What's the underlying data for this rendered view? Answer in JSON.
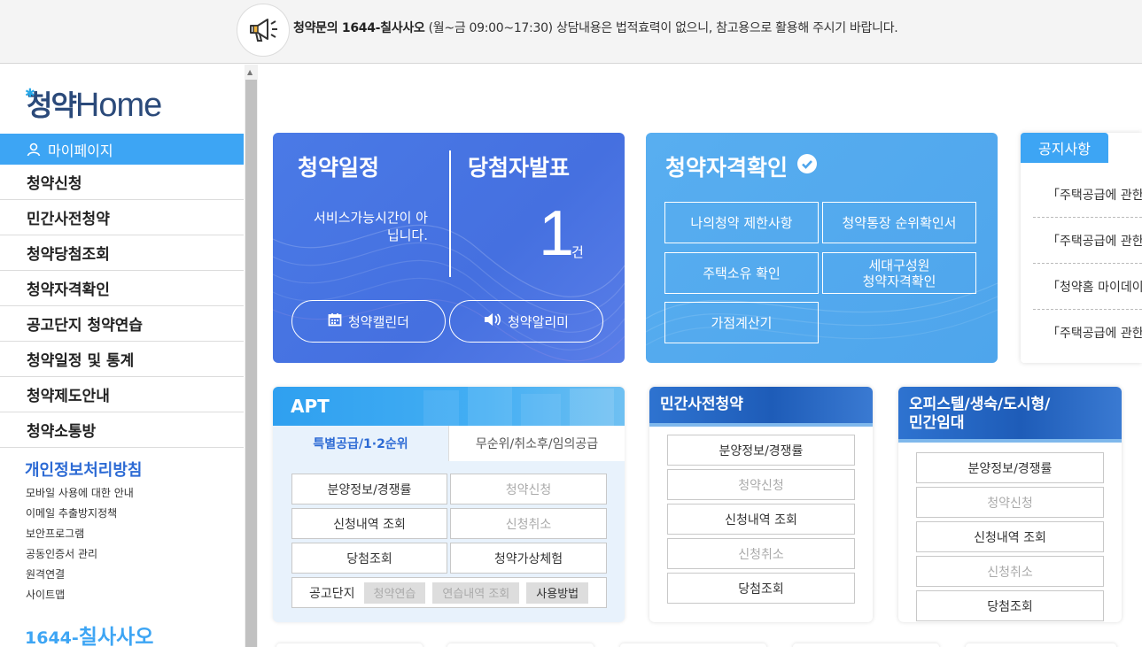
{
  "topbar": {
    "notice_bold": "청약문의 1644-칠사사오",
    "notice_hours": " (월~금 09:00~17:30)",
    "notice_rest": " 상담내용은 법적효력이 없으니, 참고용으로 활용해 주시기 바랍니다."
  },
  "sidebar": {
    "logo_ko": "청약",
    "logo_en": "Home",
    "mypage": "마이페이지",
    "items": [
      "청약신청",
      "민간사전청약",
      "청약당첨조회",
      "청약자격확인",
      "공고단지 청약연습",
      "청약일정 및 통계",
      "청약제도안내",
      "청약소통방"
    ],
    "privacy": "개인정보처리방침",
    "links": [
      "모바일 사용에 대한 안내",
      "이메일 추출방지정책",
      "보안프로그램",
      "공동인증서 관리",
      "원격연결",
      "사이트맵"
    ],
    "call_prefix": "1644-",
    "call_word": "칠사사오"
  },
  "card1": {
    "title_schedule": "청약일정",
    "title_winners": "당첨자발표",
    "service_text": "서비스가능시간이 아닙니다.",
    "count": "1",
    "unit": "건",
    "btn_calendar": "청약캘린더",
    "btn_alert": "청약알리미"
  },
  "card2": {
    "title": "청약자격확인",
    "buttons": [
      "나의청약 제한사항",
      "청약통장 순위확인서",
      "주택소유 확인",
      "세대구성원\n청약자격확인",
      "가점계산기"
    ]
  },
  "notice": {
    "tab": "공지사항",
    "items": [
      "「주택공급에 관한",
      "「주택공급에 관한",
      "「청약홈 마이데이",
      "「주택공급에 관한"
    ]
  },
  "apt": {
    "title": "APT",
    "tab_active": "특별공급/1·2순위",
    "tab_inactive": "무순위/취소후/임의공급",
    "buttons": [
      "분양정보/경쟁률",
      "청약신청",
      "신청내역 조회",
      "신청취소",
      "당첨조회",
      "청약가상체험"
    ],
    "row_label": "공고단지",
    "chips": [
      "청약연습",
      "연습내역 조회",
      "사용방법"
    ]
  },
  "private": {
    "title": "민간사전청약",
    "buttons": [
      "분양정보/경쟁률",
      "청약신청",
      "신청내역 조회",
      "신청취소",
      "당첨조회"
    ]
  },
  "officetel": {
    "title_line1": "오피스텔/생숙/도시형/",
    "title_line2": "민간임대",
    "buttons": [
      "분양정보/경쟁률",
      "청약신청",
      "신청내역 조회",
      "신청취소",
      "당첨조회"
    ]
  },
  "colors": {
    "accent": "#3da5f4",
    "card_blue": "#4a7ae6",
    "card_light": "#58aef0",
    "privacy_blue": "#2c6ad4"
  }
}
